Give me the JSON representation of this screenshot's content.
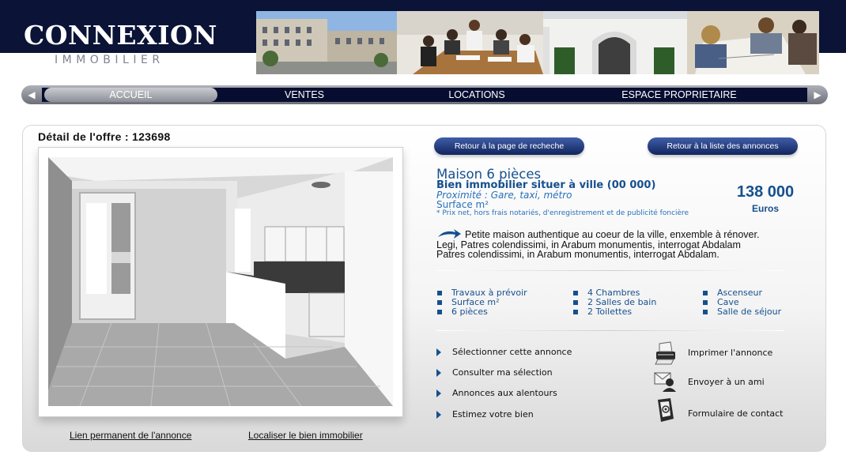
{
  "brand": {
    "name": "CONNEXION",
    "tagline": "IMMOBILIER"
  },
  "nav": {
    "items": [
      {
        "label": "ACCUEIL",
        "active": true
      },
      {
        "label": "VENTES",
        "active": false
      },
      {
        "label": "LOCATIONS",
        "active": false
      },
      {
        "label": "ESPACE PROPRIETAIRE",
        "active": false
      }
    ]
  },
  "offer": {
    "heading": "Détail de l'offre : 123698"
  },
  "buttons": {
    "back_search": "Retour à la page de recheche",
    "back_list": "Retour à la liste des annonces"
  },
  "property": {
    "title": "Maison 6 pièces",
    "subtitle": "Bien immobilier situer à ville (00 000)",
    "proximity": "Proximité : Gare, taxi, métro",
    "surface": "Surface m²",
    "note": "* Prix net, hors frais notariés, d'enregistrement et de publicité foncière",
    "price": "138 000",
    "currency": "Euros",
    "description_lines": [
      "Petite maison authentique au coeur de la ville, enxemble à rénover.",
      "Legi, Patres colendissimi, in Arabum monumentis, interrogat  Abdalam",
      "Patres colendissimi, in Arabum monumentis, interrogat  Abdalam."
    ]
  },
  "features": {
    "col1": [
      "Travaux à prévoir",
      "Surface m²",
      "6 pièces"
    ],
    "col2": [
      "4 Chambres",
      "2 Salles de bain",
      "2 Toilettes"
    ],
    "col3": [
      "Ascenseur",
      "Cave",
      "Salle de séjour"
    ]
  },
  "actions": [
    "Sélectionner cette annonce",
    "Consulter ma sélection",
    "Annonces aux alentours",
    "Estimez votre bien"
  ],
  "tools": {
    "print": "Imprimer l'annonce",
    "send": "Envoyer à un ami",
    "contact": "Formulaire de contact",
    "icons": [
      "printer-icon",
      "mail-person-icon",
      "contact-form-icon"
    ]
  },
  "links": {
    "permalink": "Lien permanent de l'annonce",
    "locate": "Localiser le bien immobilier"
  },
  "colors": {
    "navy": "#0b1336",
    "accent": "#15508e",
    "link_blue": "#2770b8"
  }
}
